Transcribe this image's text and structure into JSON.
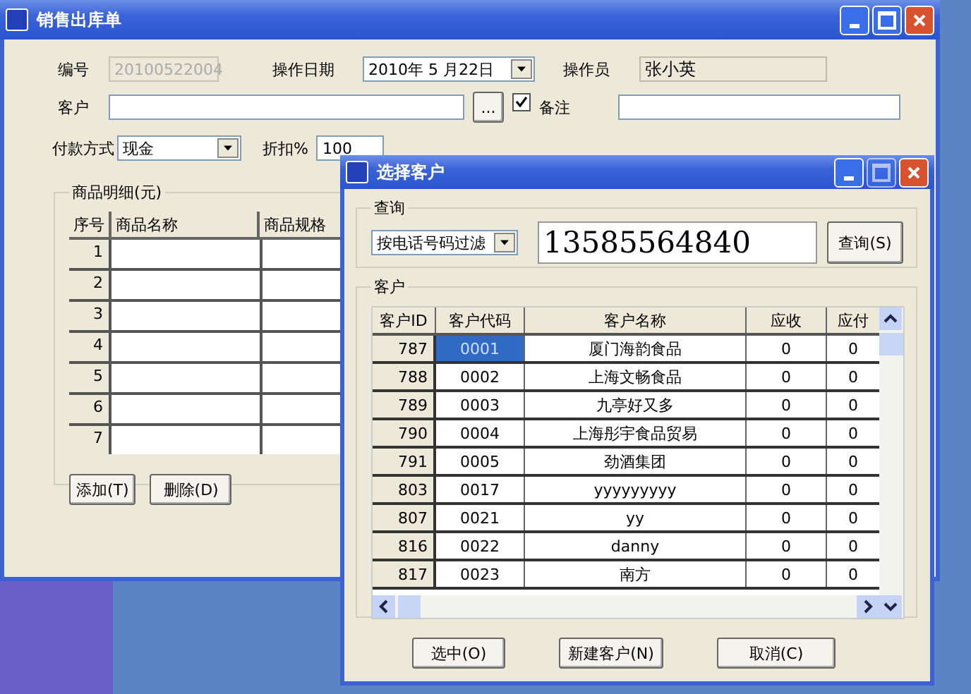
{
  "main_window": {
    "title": "销售出库单",
    "number": {
      "label": "编号",
      "value": "20100522004",
      "disabled": true
    },
    "date": {
      "label": "操作日期",
      "value": "2010年 5 月22日"
    },
    "operator": {
      "label": "操作员",
      "value": "张小英"
    },
    "customer": {
      "label": "客户",
      "browse": "...",
      "checked": true
    },
    "remark": {
      "label": "备注"
    },
    "payment": {
      "label": "付款方式",
      "value": "现金"
    },
    "discount": {
      "label": "折扣%",
      "value": "100"
    },
    "details": {
      "title": "商品明细(元)",
      "columns": [
        "序号",
        "商品名称",
        "商品规格"
      ],
      "rows": [
        "1",
        "2",
        "3",
        "4",
        "5",
        "6",
        "7"
      ]
    },
    "buttons": [
      "添加(T)",
      "删除(D)"
    ]
  },
  "dialog": {
    "title": "选择客户",
    "query": {
      "title": "查询",
      "filter": "按电话号码过滤",
      "value": "13585564840",
      "button": "查询(S)"
    },
    "customers": {
      "title": "客户",
      "columns": [
        "客户ID",
        "客户代码",
        "客户名称",
        "应收",
        "应付"
      ],
      "rows": [
        {
          "id": "787",
          "code": "0001",
          "name": "厦门海韵食品",
          "receivable": "0",
          "payable": "0",
          "selected": true
        },
        {
          "id": "788",
          "code": "0002",
          "name": "上海文畅食品",
          "receivable": "0",
          "payable": "0",
          "selected": false
        },
        {
          "id": "789",
          "code": "0003",
          "name": "九亭好又多",
          "receivable": "0",
          "payable": "0",
          "selected": false
        },
        {
          "id": "790",
          "code": "0004",
          "name": "上海彤宇食品贸易",
          "receivable": "0",
          "payable": "0",
          "selected": false
        },
        {
          "id": "791",
          "code": "0005",
          "name": "劲酒集团",
          "receivable": "0",
          "payable": "0",
          "selected": false
        },
        {
          "id": "803",
          "code": "0017",
          "name": "yyyyyyyyy",
          "receivable": "0",
          "payable": "0",
          "selected": false
        },
        {
          "id": "807",
          "code": "0021",
          "name": "yy",
          "receivable": "0",
          "payable": "0",
          "selected": false
        },
        {
          "id": "816",
          "code": "0022",
          "name": "danny",
          "receivable": "0",
          "payable": "0",
          "selected": false
        },
        {
          "id": "817",
          "code": "0023",
          "name": "南方",
          "receivable": "0",
          "payable": "0",
          "selected": false
        }
      ]
    },
    "buttons": [
      "选中(O)",
      "新建客户(N)",
      "取消(C)"
    ]
  }
}
